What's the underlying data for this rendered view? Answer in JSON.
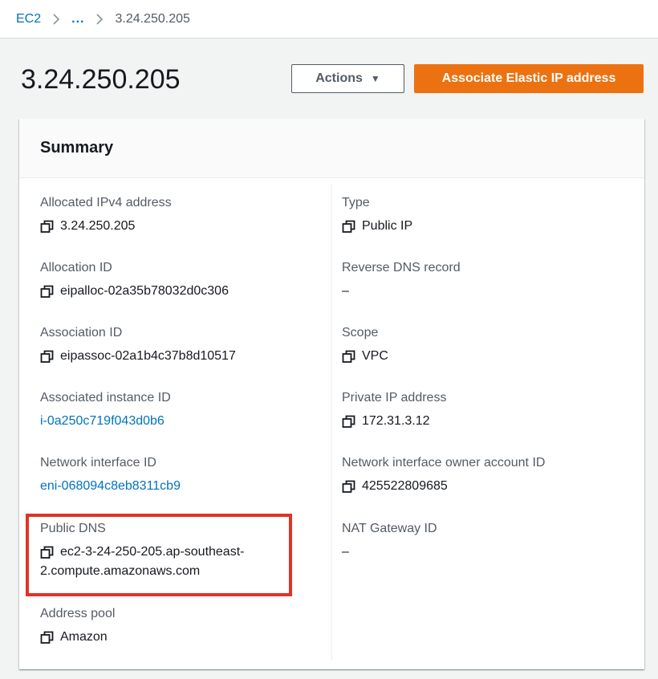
{
  "breadcrumb": {
    "root": "EC2",
    "ellipsis": "...",
    "current": "3.24.250.205"
  },
  "header": {
    "title": "3.24.250.205",
    "actions_label": "Actions",
    "associate_label": "Associate Elastic IP address"
  },
  "summary": {
    "title": "Summary",
    "left": [
      {
        "label": "Allocated IPv4 address",
        "value": "3.24.250.205",
        "kind": "copy"
      },
      {
        "label": "Allocation ID",
        "value": "eipalloc-02a35b78032d0c306",
        "kind": "copy"
      },
      {
        "label": "Association ID",
        "value": "eipassoc-02a1b4c37b8d10517",
        "kind": "copy"
      },
      {
        "label": "Associated instance ID",
        "value": "i-0a250c719f043d0b6",
        "kind": "link"
      },
      {
        "label": "Network interface ID",
        "value": "eni-068094c8eb8311cb9",
        "kind": "link"
      },
      {
        "label": "Public DNS",
        "value_line1": "ec2-3-24-250-205.ap-southeast-",
        "value_line2": "2.compute.amazonaws.com",
        "kind": "copy"
      },
      {
        "label": "Address pool",
        "value": "Amazon",
        "kind": "copy"
      }
    ],
    "right": [
      {
        "label": "Type",
        "value": "Public IP",
        "kind": "copy"
      },
      {
        "label": "Reverse DNS record",
        "value": "–",
        "kind": "text"
      },
      {
        "label": "Scope",
        "value": "VPC",
        "kind": "copy"
      },
      {
        "label": "Private IP address",
        "value": "172.31.3.12",
        "kind": "copy"
      },
      {
        "label": "Network interface owner account ID",
        "value": "425522809685",
        "kind": "copy"
      },
      {
        "label": "NAT Gateway ID",
        "value": "–",
        "kind": "text"
      }
    ]
  },
  "colors": {
    "accent": "#ec7211",
    "link": "#0073bb",
    "highlight": "#e13323"
  },
  "icons": {
    "copy": "copy-icon",
    "chevron": "chevron-right-icon",
    "caret": "caret-down-icon"
  }
}
